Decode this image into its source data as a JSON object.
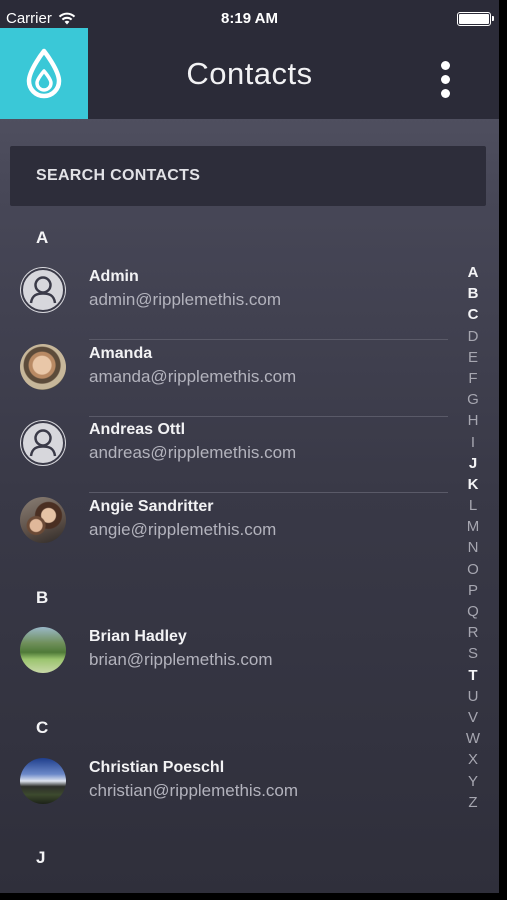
{
  "status_bar": {
    "carrier": "Carrier",
    "time": "8:19 AM"
  },
  "nav": {
    "title": "Contacts",
    "logo_icon": "water-drop-icon",
    "menu_icon": "more-vertical-icon"
  },
  "search": {
    "placeholder": "SEARCH CONTACTS"
  },
  "sections": [
    {
      "letter": "A",
      "contacts": [
        {
          "name": "Admin",
          "email": "admin@ripplemethis.com",
          "avatar": "default"
        },
        {
          "name": "Amanda",
          "email": "amanda@ripplemethis.com",
          "avatar": "photo"
        },
        {
          "name": "Andreas Ottl",
          "email": "andreas@ripplemethis.com",
          "avatar": "default"
        },
        {
          "name": "Angie Sandritter",
          "email": "angie@ripplemethis.com",
          "avatar": "photo"
        }
      ]
    },
    {
      "letter": "B",
      "contacts": [
        {
          "name": "Brian Hadley",
          "email": "brian@ripplemethis.com",
          "avatar": "photo"
        }
      ]
    },
    {
      "letter": "C",
      "contacts": [
        {
          "name": "Christian Poeschl",
          "email": "christian@ripplemethis.com",
          "avatar": "photo"
        }
      ]
    },
    {
      "letter": "J",
      "contacts": []
    }
  ],
  "alpha_index": [
    "A",
    "B",
    "C",
    "D",
    "E",
    "F",
    "G",
    "H",
    "I",
    "J",
    "K",
    "L",
    "M",
    "N",
    "O",
    "P",
    "Q",
    "R",
    "S",
    "T",
    "U",
    "V",
    "W",
    "X",
    "Y",
    "Z"
  ],
  "alpha_active": [
    "A",
    "B",
    "C",
    "J",
    "K",
    "T"
  ],
  "colors": {
    "accent": "#3ac8d7",
    "bar": "#2b2b38"
  }
}
